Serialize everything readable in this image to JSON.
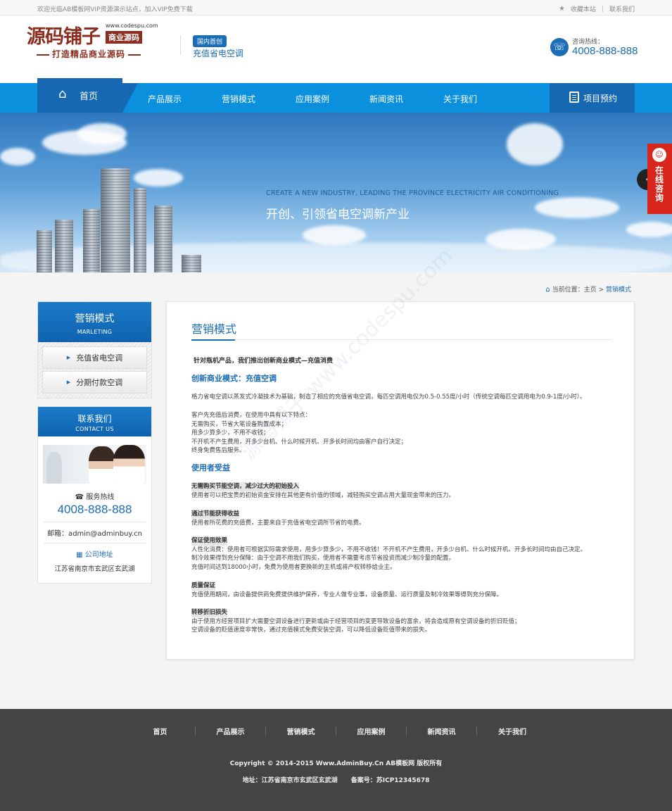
{
  "topbar": {
    "welcome": "欢迎光临AB模板网VIP资源演示站点，加入VIP免费下载",
    "favorite": "收藏本站",
    "separator": "|",
    "contact": "联系我们"
  },
  "header": {
    "logo_text": "源码铺子",
    "logo_site": "www.codespu.com",
    "logo_biz": "商业源码",
    "logo_slogan": "打造精品商业源码",
    "badge": "国内首创",
    "subtitle": "充值省电空调",
    "hotline_label": "咨询热线：",
    "hotline_number": "4008-888-888"
  },
  "nav": {
    "home": "首页",
    "items": [
      "产品展示",
      "营销模式",
      "应用案例",
      "新闻资讯",
      "关于我们"
    ],
    "appointment": "项目预约"
  },
  "banner": {
    "en": "CREATE A NEW INDUSTRY, LEADING THE PROVINCE ELECTRICITY AIR CONDITIONING",
    "cn": "开创、引领省电空调新产业"
  },
  "float_consult": {
    "label": "在线咨询"
  },
  "breadcrumb": {
    "prefix": "当前位置：",
    "home": "主页",
    "sep": ">",
    "current": "营销模式"
  },
  "sidebar": {
    "title": "营销模式",
    "title_en": "MARLETING",
    "items": [
      "充值省电空调",
      "分期付款空调"
    ],
    "contact_title": "联系我们",
    "contact_title_en": "CONTACT US",
    "service_label": "服务热线",
    "service_number": "4008-888-888",
    "email": "邮箱：admin@adminbuy.cn",
    "address_title": "公司地址",
    "address": "江苏省南京市玄武区玄武湖"
  },
  "main": {
    "title": "营销模式",
    "intro": "针对瓶机产品，我们推出创新商业模式—充值消费",
    "h1": "创新商业模式：充值空调",
    "p1": "格力省电空调以蒸发式冷凝技术为基础，制造了相应的充值省电空调，每匹空调用电仅为0.5-0.55度/小时（传统空调每匹空调用电为0.9-1度/小时）。",
    "p2": [
      "客户先充值后消费，在使用中具有以下特点：",
      "无需购买，节省大笔设备购置成本；",
      "用多少算多少，不用不收钱；",
      "不开机不产生费用，开多少台机、什么时候开机、开多长时间均由客户自行决定；",
      "终身免费售后服务。"
    ],
    "h2": "使用者受益",
    "s1": "无需购买节能空调，减少过大的初始投入",
    "s1p": "使用者可以把宝贵的初始资金安排在其他更有价值的领域，减轻购买空调占用大量现金带来的压力。",
    "s2": "通过节能获得收益",
    "s2p": "使用者所花费的充值费，主要来自于充值省电空调所节省的电费。",
    "s3": "保证使用效果",
    "s3p": [
      "人性化消费：使用者可根据实际需求使用，用多少算多少，不用不收钱！不开机不产生费用，开多少台机、什么时候开机、开多长时间均由自己决定。",
      "制冷效果得到充分保障：由于空调不用我们购买，使用者不需要考虑节省投资而减少制冷量的配置。",
      "充值时间达到18000小时，免费为使用者更换新的主机或将产权转移给业主。"
    ],
    "s4": "质量保证",
    "s4p": "充值使用期间，由设备提供商免费提供维护保养，专业人做专业事，设备质量、运行质量及制冷效果等得到充分保障。",
    "s5": "转移折旧损失",
    "s5p": [
      "由于使用方经营项目扩大需要空调设备进行更新或由于经营项目的变更导致设备的富余，将会造成原有空调设备的折旧贬值；",
      "空调设备的贬值速度非常快，通过充值模式免费安装空调，可以降低设备贬值带来的损失。"
    ]
  },
  "watermark": "源码铺子 www.codespu.com",
  "footer": {
    "nav": [
      "首页",
      "产品展示",
      "营销模式",
      "应用案例",
      "新闻资讯",
      "关于我们"
    ],
    "copyright": "Copyright © 2014-2015 Www.AdminBuy.Cn AB模板网 版权所有",
    "address": "地址：江苏省南京市玄武区玄武湖",
    "icp": "备案号：苏ICP12345678"
  },
  "colors": {
    "primary": "#1b6db5",
    "nav": "#0a90dc",
    "brand": "#8b2e1f",
    "consult": "#d9261c",
    "footer": "#444444"
  }
}
